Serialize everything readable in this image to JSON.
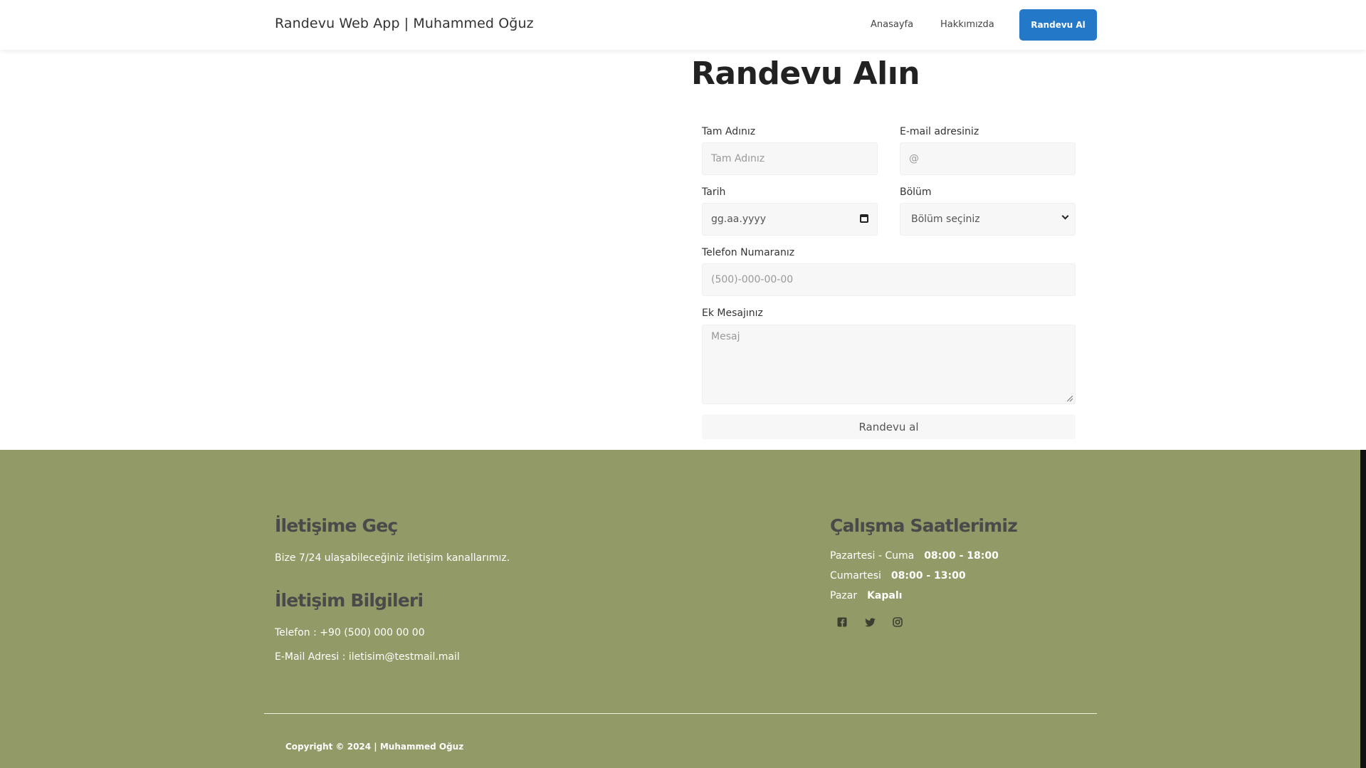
{
  "navbar": {
    "brand": "Randevu Web App | Muhammed Oğuz",
    "links": [
      "Anasayfa",
      "Hakkımızda"
    ],
    "cta": "Randevu Al"
  },
  "form": {
    "title": "Randevu Alın",
    "name_label": "Tam Adınız",
    "name_placeholder": "Tam Adınız",
    "email_label": "E-mail adresiniz",
    "email_placeholder": "@",
    "date_label": "Tarih",
    "date_placeholder": "gg.aa.yyyy",
    "department_label": "Bölüm",
    "department_selected": "Bölüm seçiniz",
    "phone_label": "Telefon Numaranız",
    "phone_placeholder": "(500)-000-00-00",
    "message_label": "Ek Mesajınız",
    "message_placeholder": "Mesaj",
    "submit": "Randevu al"
  },
  "footer": {
    "contact_heading": "İletişime Geç",
    "contact_text": "Bize 7/24 ulaşabileceğiniz iletişim kanallarımız.",
    "info_heading": "İletişim Bilgileri",
    "phone": "Telefon : +90 (500) 000 00 00",
    "email": "E-Mail Adresi : iletisim@testmail.mail",
    "hours_heading": "Çalışma Saatlerimiz",
    "hours": [
      {
        "day": "Pazartesi - Cuma",
        "time": "08:00 - 18:00"
      },
      {
        "day": "Cumartesi",
        "time": "08:00 - 13:00"
      },
      {
        "day": "Pazar",
        "time": "Kapalı"
      }
    ],
    "social_icons": [
      "facebook-icon",
      "twitter-icon",
      "instagram-icon"
    ],
    "copyright": "Copyright © 2024 | Muhammed Oğuz"
  },
  "colors": {
    "accent": "#2378c8",
    "footer_bg": "#929b67"
  }
}
